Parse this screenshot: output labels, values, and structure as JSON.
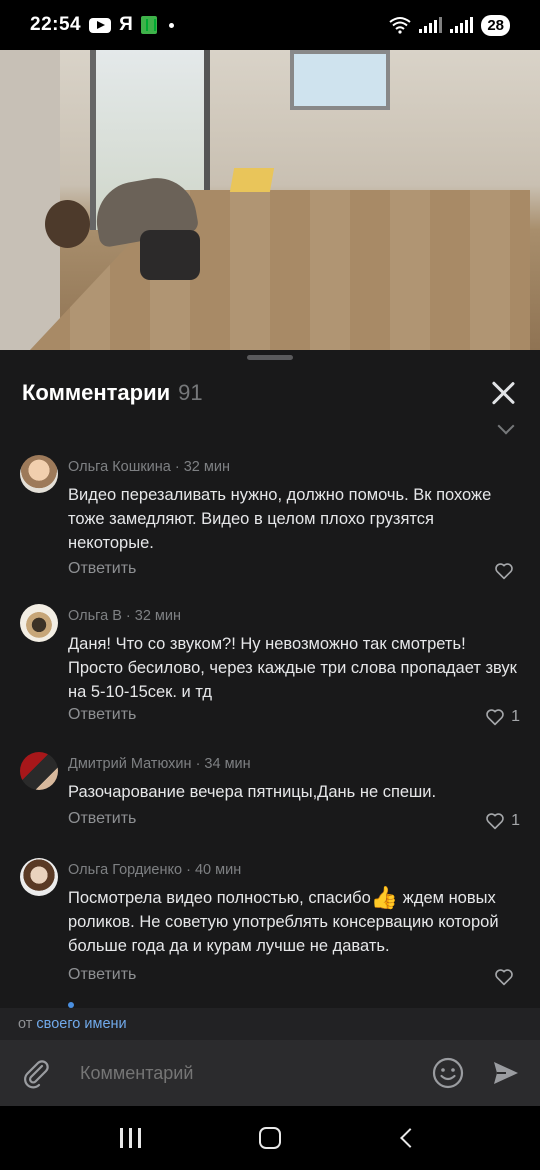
{
  "status_bar": {
    "time": "22:54",
    "carrier_glyph": "Я",
    "battery": "28",
    "icons": [
      "youtube-icon",
      "yandex-icon",
      "app-icon",
      "wifi-icon",
      "signal-icon",
      "signal-icon-2"
    ]
  },
  "sheet": {
    "title": "Комментарии",
    "count": "91"
  },
  "comments": [
    {
      "author": "Ольга Кошкина",
      "time": "· 32 мин",
      "text": "Видео перезаливать нужно, должно помочь. Вк похоже тоже замедляют. Видео в целом плохо грузятся некоторые.",
      "reply_label": "Ответить",
      "likes": ""
    },
    {
      "author": "Ольга В",
      "time": "· 32 мин",
      "text": "Даня! Что со звуком?! Ну невозможно так смотреть! Просто бесилово, через каждые три слова пропадает звук на 5-10-15сек. и тд",
      "reply_label": "Ответить",
      "likes": "1"
    },
    {
      "author": "Дмитрий Матюхин",
      "time": "· 34 мин",
      "text": "Разочарование вечера пятницы,Дань не спеши.",
      "reply_label": "Ответить",
      "likes": "1"
    },
    {
      "author": "Ольга Гордиенко",
      "time": "· 40 мин",
      "text_before": "Посмотрела видео полностью, спасибо",
      "emoji": "👍",
      "text_after": " ждем новых роликов. Не советую употреблять  консервацию которой больше года да и курам лучше не давать.",
      "reply_label": "Ответить",
      "likes": ""
    }
  ],
  "from_bar": {
    "prefix": "от",
    "link": "своего имени"
  },
  "input_bar": {
    "placeholder": "Комментарий"
  },
  "colors": {
    "sheet_bg": "#19191a",
    "link": "#71aaeb",
    "muted": "#7e8083"
  }
}
